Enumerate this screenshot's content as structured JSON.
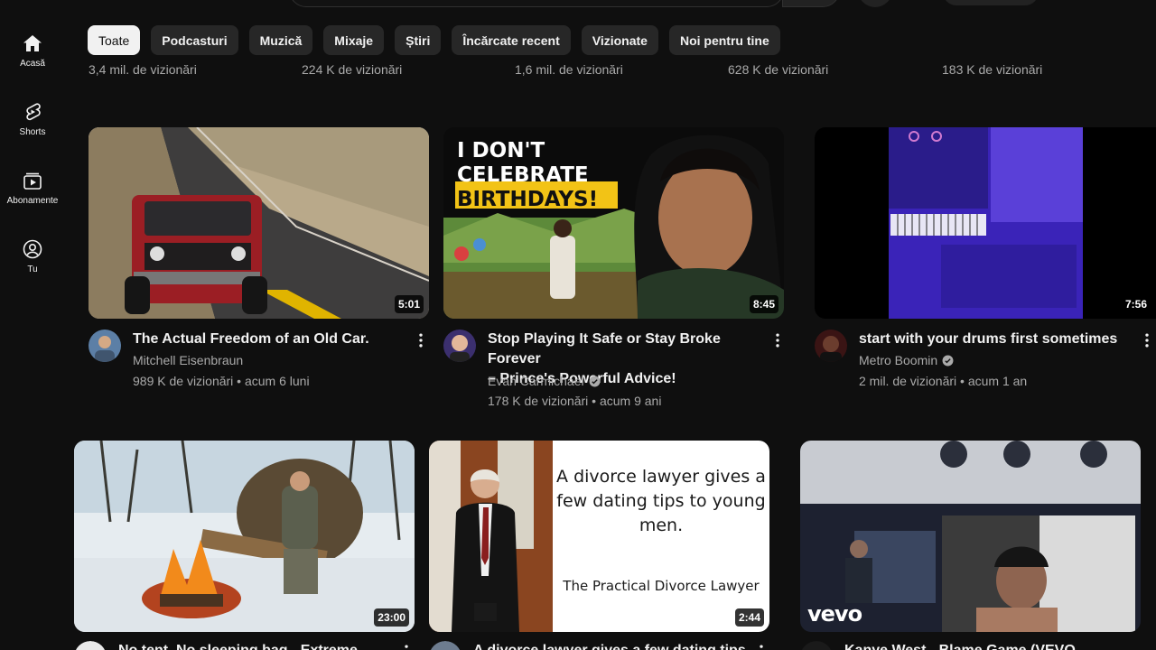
{
  "rail": [
    {
      "label": "Acasă",
      "icon": "home-icon"
    },
    {
      "label": "Shorts",
      "icon": "shorts-icon"
    },
    {
      "label": "Abonamente",
      "icon": "subscriptions-icon"
    },
    {
      "label": "Tu",
      "icon": "you-icon"
    }
  ],
  "chips": [
    "Toate",
    "Podcasturi",
    "Muzică",
    "Mixaje",
    "Știri",
    "Încărcate recent",
    "Vizionate",
    "Noi pentru tine"
  ],
  "previous_row_stats": [
    "3,4 mil. de vizionări",
    "224 K de vizionări",
    "1,6 mil. de vizionări",
    "628 K de vizionări",
    "183 K de vizionări"
  ],
  "row1": [
    {
      "title_lines": [
        "The Actual Freedom of an Old Car."
      ],
      "channel": "Mitchell Eisenbraun",
      "verified": false,
      "meta": "989 K de vizionări • acum 6 luni",
      "duration": "5:01"
    },
    {
      "title_lines": [
        "Stop Playing It Safe or Stay Broke Forever",
        "– Prince's Powerful Advice!"
      ],
      "channel": "Evan Carmichael",
      "verified": true,
      "meta": "178 K de vizionări • acum 9 ani",
      "duration": "8:45",
      "thumb_text": [
        "I DON'T",
        "CELEBRATE",
        "BIRTHDAYS!"
      ]
    },
    {
      "title_lines": [
        "start with your drums first sometimes"
      ],
      "channel": "Metro Boomin",
      "verified": true,
      "meta": "2 mil. de vizionări • acum 1 an",
      "duration": "7:56"
    }
  ],
  "row2": [
    {
      "duration": "23:00",
      "title_cut": "No tent, No sleeping bag - Extreme..."
    },
    {
      "duration": "2:44",
      "thumb_text": [
        "A divorce lawyer gives a",
        "few dating tips to young",
        "men."
      ],
      "thumb_sub": "The Practical Divorce Lawyer",
      "title_cut": "A divorce lawyer gives a few dating tips..."
    },
    {
      "logo": "vevo",
      "title_cut": "Kanye West - Blame Game (VEVO..."
    }
  ]
}
